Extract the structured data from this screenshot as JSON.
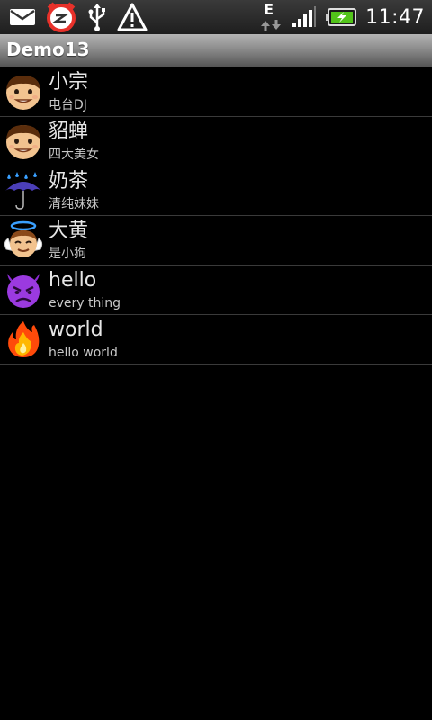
{
  "status_bar": {
    "time": "11:47",
    "network_type": "E",
    "icons": [
      "mail-icon",
      "alarm-clock-icon",
      "usb-icon",
      "warning-icon",
      "data-arrows-icon",
      "signal-icon",
      "battery-charging-icon"
    ],
    "colors": {
      "alarm": "#e8312a",
      "battery_fill": "#52c41a"
    }
  },
  "app": {
    "title": "Demo13"
  },
  "list": {
    "items": [
      {
        "title": "小宗",
        "subtitle": "电台DJ",
        "icon": "boy-face-icon"
      },
      {
        "title": "貂蝉",
        "subtitle": "四大美女",
        "icon": "boy-face-icon"
      },
      {
        "title": "奶茶",
        "subtitle": "清纯妹妹",
        "icon": "rain-umbrella-icon"
      },
      {
        "title": "大黄",
        "subtitle": "是小狗",
        "icon": "angel-face-icon"
      },
      {
        "title": "hello",
        "subtitle": "every thing",
        "icon": "devil-face-icon"
      },
      {
        "title": "world",
        "subtitle": "hello world",
        "icon": "fire-icon"
      }
    ]
  }
}
